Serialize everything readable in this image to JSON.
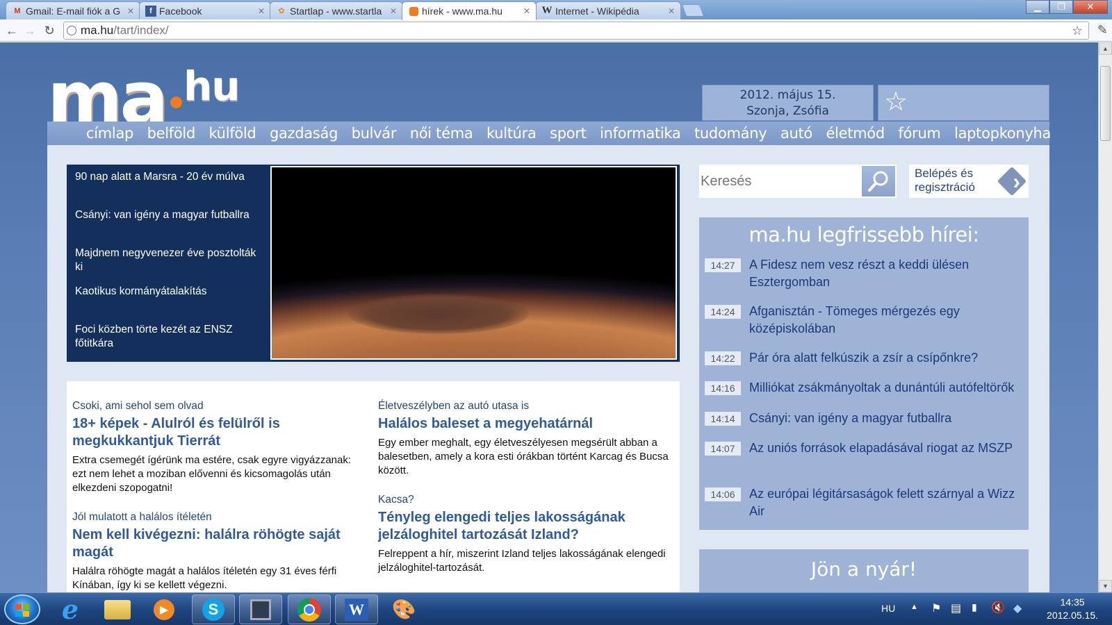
{
  "browser": {
    "tabs": [
      {
        "title": "Gmail: E-mail fiók a G",
        "icon": "gmail-icon"
      },
      {
        "title": "Facebook",
        "icon": "facebook-icon"
      },
      {
        "title": "Startlap - www.startla",
        "icon": "startlap-icon"
      },
      {
        "title": "hírek - www.ma.hu",
        "icon": "mahu-icon",
        "active": true
      },
      {
        "title": "Internet - Wikipédia",
        "icon": "wikipedia-icon"
      }
    ],
    "address": {
      "host": "ma.hu",
      "path": "/tart/index/"
    }
  },
  "site": {
    "logo_ma": "ma",
    "logo_hu": "hu",
    "date_line1": "2012. május 15.",
    "date_line2": "Szonja, Zsófia",
    "nav": [
      "címlap",
      "belföld",
      "külföld",
      "gazdaság",
      "bulvár",
      "női téma",
      "kultúra",
      "sport",
      "informatika",
      "tudomány",
      "autó",
      "életmód",
      "fórum",
      "laptopkonyha"
    ]
  },
  "featured": [
    "90 nap alatt a Marsra - 20 év múlva",
    "Csányi: van igény a magyar futballra",
    "Majdnem negyvenezer éve posztolták ki",
    "Kaotikus kormányátalakítás",
    "Foci közben törte kezét az ENSZ főtitkára"
  ],
  "articles": [
    {
      "kicker": "Csoki, ami sehol sem olvad",
      "headline": "18+ képek - Alulról és felülről is megkukkantjuk Tierrát",
      "lead": "Extra csemegét ígérünk ma estére, csak egyre vigyázzanak: ezt nem lehet a moziban elővenni és kicsomagolás után elkezdeni szopogatni!"
    },
    {
      "kicker": "Életveszélyben az autó utasa is",
      "headline": "Halálos baleset a megyehatárnál",
      "lead": "Egy ember meghalt, egy életveszélyesen megsérült abban a balesetben, amely a kora esti órákban történt Karcag és Bucsa között."
    },
    {
      "kicker": "Jól mulatott a halálos ítéletén",
      "headline": "Nem kell kivégezni: halálra röhögte saját magát",
      "lead": "Halálra röhögte magát a halálos ítéletén egy 31 éves férfi Kínában, így ki se kellett végezni."
    },
    {
      "kicker": "Kacsa?",
      "headline": "Tényleg elengedi teljes lakosságának jelzáloghitel tartozását Izland?",
      "lead": "Felreppent a hír, miszerint Izland teljes lakosságának elengedi jelzáloghitel-tartozását."
    }
  ],
  "search": {
    "placeholder": "Keresés"
  },
  "login": {
    "line1": "Belépés és",
    "line2": "regisztráció"
  },
  "latest": {
    "heading": "ma.hu legfrissebb hírei:",
    "items": [
      {
        "time": "14:27",
        "title": "A Fidesz nem vesz részt a keddi ülésen Esztergomban"
      },
      {
        "time": "14:24",
        "title": "Afganisztán - Tömeges mérgezés egy középiskolában"
      },
      {
        "time": "14:22",
        "title": "Pár óra alatt felkúszik a zsír a csípőnkre?"
      },
      {
        "time": "14:16",
        "title": "Milliókat zsákmányoltak a dunántúli autófeltörők"
      },
      {
        "time": "14:14",
        "title": "Csányi: van igény a magyar futballra"
      },
      {
        "time": "14:07",
        "title": "Az uniós források elapadásával riogat az MSZP"
      },
      {
        "time": "14:06",
        "title": "Az európai légitársaságok felett szárnyal a Wizz Air"
      }
    ]
  },
  "summer": {
    "heading": "Jön a nyár!"
  },
  "taskbar": {
    "language": "HU",
    "time": "14:35",
    "date": "2012.05.15."
  }
}
